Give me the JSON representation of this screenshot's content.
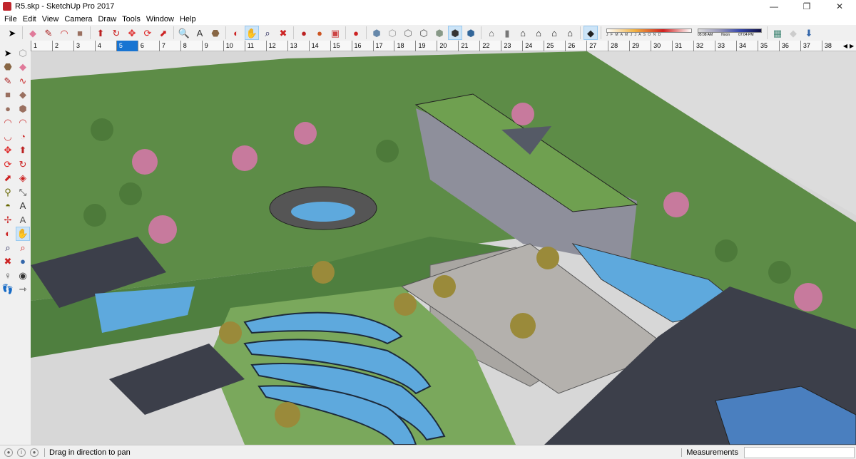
{
  "window": {
    "title": "R5.skp - SketchUp Pro 2017",
    "controls": [
      "—",
      "❐",
      "✕"
    ]
  },
  "menu": [
    "File",
    "Edit",
    "View",
    "Camera",
    "Draw",
    "Tools",
    "Window",
    "Help"
  ],
  "toolbar": {
    "groups": [
      [
        {
          "name": "select-icon",
          "g": "➤",
          "c": "#000"
        }
      ],
      [
        {
          "name": "eraser-icon",
          "g": "◆",
          "c": "#e07a9a"
        },
        {
          "name": "pencil-line-icon",
          "g": "✎",
          "c": "#a22"
        },
        {
          "name": "arc-icon",
          "g": "◠",
          "c": "#c33"
        },
        {
          "name": "rectangle-icon",
          "g": "■",
          "c": "#9a7060"
        }
      ],
      [
        {
          "name": "push-pull-icon",
          "g": "⬆",
          "c": "#b22"
        },
        {
          "name": "follow-me-icon",
          "g": "↻",
          "c": "#c22"
        },
        {
          "name": "move-icon",
          "g": "✥",
          "c": "#d22"
        },
        {
          "name": "rotate-icon",
          "g": "⟳",
          "c": "#d22"
        },
        {
          "name": "scale-icon",
          "g": "⬈",
          "c": "#c22"
        }
      ],
      [
        {
          "name": "tape-measure-icon",
          "g": "🔍",
          "c": "#660"
        },
        {
          "name": "text-icon",
          "g": "A",
          "c": "#333"
        },
        {
          "name": "paint-bucket-icon",
          "g": "⬣",
          "c": "#864"
        }
      ],
      [
        {
          "name": "orbit-icon",
          "g": "◐",
          "c": "#c22"
        },
        {
          "name": "pan-icon",
          "g": "✋",
          "c": "#bb8",
          "active": true
        },
        {
          "name": "zoom-icon",
          "g": "⌕",
          "c": "#225"
        },
        {
          "name": "zoom-extents-icon",
          "g": "✖",
          "c": "#c22"
        }
      ],
      [
        {
          "name": "warehouse-icon",
          "g": "●",
          "c": "#b22"
        },
        {
          "name": "share-model-icon",
          "g": "●",
          "c": "#c52"
        },
        {
          "name": "extension-warehouse-icon",
          "g": "▣",
          "c": "#c44"
        }
      ],
      [
        {
          "name": "extension-icon",
          "g": "●",
          "c": "#c22"
        }
      ],
      [
        {
          "name": "xray-icon",
          "g": "⬢",
          "c": "#68a"
        },
        {
          "name": "back-edges-icon",
          "g": "⬡",
          "c": "#999"
        },
        {
          "name": "wireframe-icon",
          "g": "⬡",
          "c": "#666"
        },
        {
          "name": "hidden-line-icon",
          "g": "⬡",
          "c": "#444"
        },
        {
          "name": "shaded-icon",
          "g": "⬢",
          "c": "#898"
        },
        {
          "name": "shaded-textures-icon",
          "g": "⬢",
          "c": "#333",
          "active": true
        },
        {
          "name": "monochrome-icon",
          "g": "⬢",
          "c": "#369"
        }
      ],
      [
        {
          "name": "iso-view-icon",
          "g": "⌂",
          "c": "#555"
        },
        {
          "name": "top-view-icon",
          "g": "▮",
          "c": "#777"
        },
        {
          "name": "front-view-icon",
          "g": "⌂",
          "c": "#111"
        },
        {
          "name": "right-view-icon",
          "g": "⌂",
          "c": "#111"
        },
        {
          "name": "back-view-icon",
          "g": "⌂",
          "c": "#111"
        },
        {
          "name": "left-view-icon",
          "g": "⌂",
          "c": "#111"
        }
      ],
      [
        {
          "name": "shadows-icon",
          "g": "◆",
          "c": "#222",
          "active": true
        }
      ]
    ],
    "shadow_months": "J F M A M J J A S O N D",
    "shadow_time_start": "05:08 AM",
    "shadow_time_mid": "Noon",
    "shadow_time_end": "07:04 PM",
    "location_tools": [
      {
        "name": "add-location-icon",
        "g": "▦",
        "c": "#487"
      },
      {
        "name": "toggle-terrain-icon",
        "g": "◆",
        "c": "#ccc"
      },
      {
        "name": "photo-textures-icon",
        "g": "⬇",
        "c": "#36a"
      }
    ]
  },
  "scenes": {
    "tabs": [
      "1",
      "2",
      "3",
      "4",
      "5",
      "6",
      "7",
      "8",
      "9",
      "10",
      "11",
      "12",
      "13",
      "14",
      "15",
      "16",
      "17",
      "18",
      "19",
      "20",
      "21",
      "22",
      "23",
      "24",
      "25",
      "26",
      "27",
      "28",
      "29",
      "30",
      "31",
      "32",
      "33",
      "34",
      "35",
      "36",
      "37",
      "38"
    ],
    "selected": "5"
  },
  "left_tools": [
    {
      "name": "select-icon",
      "g": "➤",
      "c": "#000"
    },
    {
      "name": "make-component-icon",
      "g": "⬡",
      "c": "#999"
    },
    {
      "name": "paint-bucket-icon",
      "g": "⬣",
      "c": "#864"
    },
    {
      "name": "eraser-icon",
      "g": "◆",
      "c": "#e07a9a"
    },
    {
      "name": "line-icon",
      "g": "✎",
      "c": "#a22"
    },
    {
      "name": "freehand-icon",
      "g": "∿",
      "c": "#c33"
    },
    {
      "name": "rectangle-icon",
      "g": "■",
      "c": "#9a7060"
    },
    {
      "name": "rotated-rectangle-icon",
      "g": "◆",
      "c": "#9a7060"
    },
    {
      "name": "circle-icon",
      "g": "●",
      "c": "#9a7060"
    },
    {
      "name": "polygon-icon",
      "g": "⬢",
      "c": "#9a7060"
    },
    {
      "name": "arc-icon",
      "g": "◠",
      "c": "#c33"
    },
    {
      "name": "two-point-arc-icon",
      "g": "◠",
      "c": "#c33"
    },
    {
      "name": "three-point-arc-icon",
      "g": "◡",
      "c": "#c33"
    },
    {
      "name": "pie-icon",
      "g": "◔",
      "c": "#c33"
    },
    {
      "name": "move-icon",
      "g": "✥",
      "c": "#d22"
    },
    {
      "name": "push-pull-icon",
      "g": "⬆",
      "c": "#b22"
    },
    {
      "name": "rotate-icon",
      "g": "⟳",
      "c": "#d22"
    },
    {
      "name": "follow-me-icon",
      "g": "↻",
      "c": "#c22"
    },
    {
      "name": "scale-icon",
      "g": "⬈",
      "c": "#c22"
    },
    {
      "name": "offset-icon",
      "g": "◈",
      "c": "#c22"
    },
    {
      "name": "tape-measure-icon",
      "g": "⚲",
      "c": "#660"
    },
    {
      "name": "dimension-icon",
      "g": "⤡",
      "c": "#333"
    },
    {
      "name": "protractor-icon",
      "g": "◓",
      "c": "#660"
    },
    {
      "name": "text-icon",
      "g": "A",
      "c": "#333"
    },
    {
      "name": "axes-icon",
      "g": "✢",
      "c": "#c33"
    },
    {
      "name": "3d-text-icon",
      "g": "A",
      "c": "#555"
    },
    {
      "name": "orbit-icon",
      "g": "◐",
      "c": "#c22"
    },
    {
      "name": "pan-icon",
      "g": "✋",
      "c": "#bb8",
      "active": true
    },
    {
      "name": "zoom-icon",
      "g": "⌕",
      "c": "#225"
    },
    {
      "name": "zoom-window-icon",
      "g": "⌕",
      "c": "#c22"
    },
    {
      "name": "zoom-extents-icon",
      "g": "✖",
      "c": "#c22"
    },
    {
      "name": "previous-view-icon",
      "g": "●",
      "c": "#36a"
    },
    {
      "name": "position-camera-icon",
      "g": "♀",
      "c": "#333"
    },
    {
      "name": "look-around-icon",
      "g": "◉",
      "c": "#333"
    },
    {
      "name": "walk-icon",
      "g": "👣",
      "c": "#333"
    },
    {
      "name": "section-plane-icon",
      "g": "⇾",
      "c": "#333"
    }
  ],
  "status": {
    "text": "Drag in direction to pan",
    "measurements_label": "Measurements",
    "measurements_value": ""
  },
  "colors": {
    "accent": "#1874d2",
    "grass": "#5a8a45",
    "water": "#5ea9dd",
    "roof": "#3c3f4a",
    "paving": "#a9a6a2"
  }
}
